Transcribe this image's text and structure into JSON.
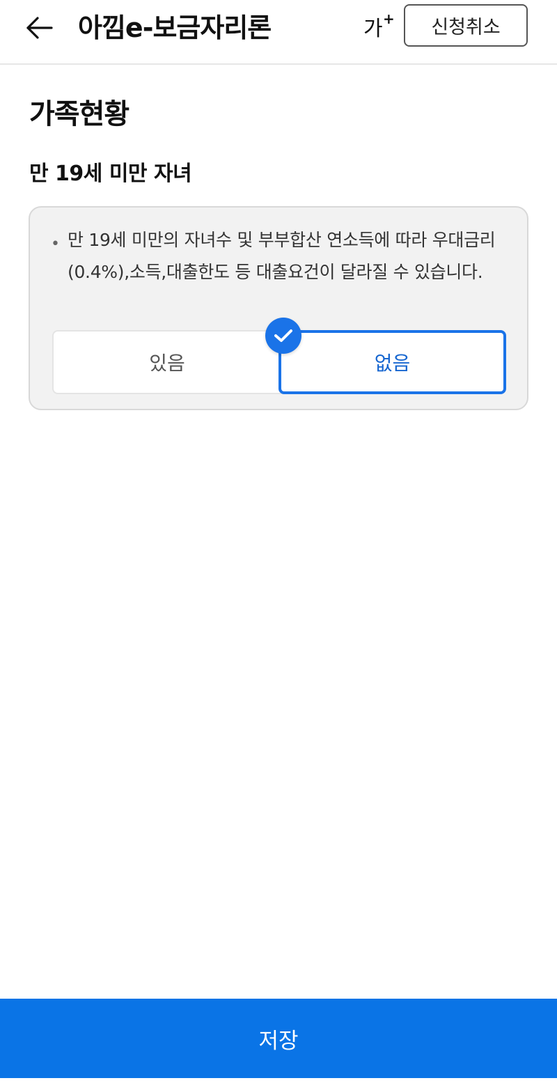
{
  "header": {
    "back_icon": "arrow-left-icon",
    "title": "아낌e-보금자리론",
    "font_size_label": "가",
    "font_size_plus": "+",
    "cancel_label": "신청취소"
  },
  "section": {
    "title": "가족현황",
    "subtitle": "만 19세 미만 자녀",
    "notice": {
      "bullet": "•",
      "text": "만 19세 미만의 자녀수 및 부부합산 연소득에 따라 우대금리(0.4%),소득,대출한도 등 대출요건이 달라질 수 있습니다."
    },
    "options": [
      {
        "label": "있음",
        "selected": false
      },
      {
        "label": "없음",
        "selected": true
      }
    ],
    "check_icon": "checkmark-icon"
  },
  "footer": {
    "save_label": "저장"
  },
  "colors": {
    "accent": "#1a73e8",
    "save_button": "#0a74e6",
    "info_box_bg": "#f2f2f2"
  }
}
